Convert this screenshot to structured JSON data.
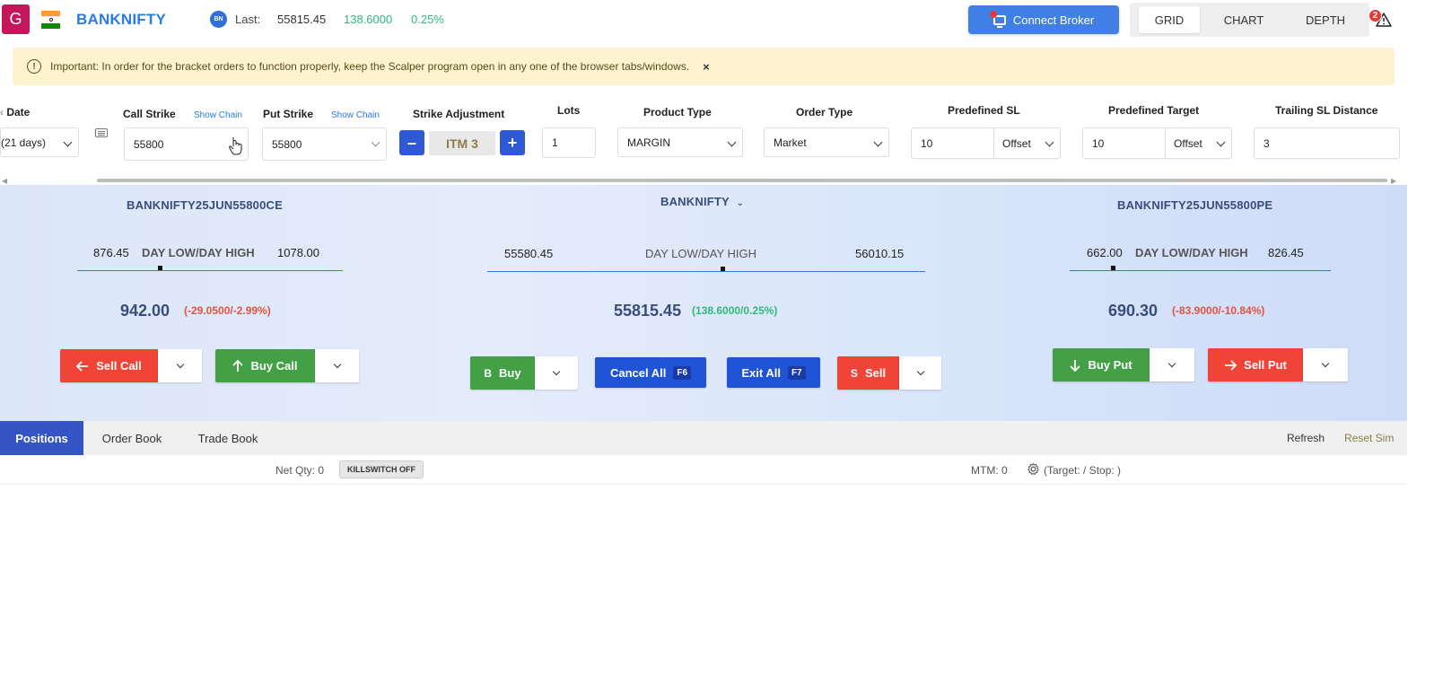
{
  "header": {
    "avatar_letter": "G",
    "symbol": "BANKNIFTY",
    "bn_icon": "BN",
    "last_label": "Last:",
    "last_price": "55815.45",
    "last_change": "138.6000",
    "last_pct": "0.25%",
    "connect_label": "Connect Broker",
    "views": [
      "GRID",
      "CHART",
      "DEPTH"
    ],
    "active_view": "GRID",
    "notif_count": "2"
  },
  "alert": {
    "icon": "!",
    "text": "Important: In order for the bracket orders to function properly, keep the Scalper program open in any one of the browser tabs/windows.",
    "close": "×"
  },
  "form": {
    "date_label": "Date",
    "date_value": "(21 days)",
    "call_strike_label": "Call Strike",
    "call_chain_link": "Show Chain",
    "call_strike_value": "55800",
    "put_strike_label": "Put Strike",
    "put_chain_link": "Show Chain",
    "put_strike_value": "55800",
    "strike_adj_label": "Strike Adjustment",
    "adj_minus": "–",
    "adj_value": "ITM 3",
    "adj_plus": "+",
    "lots_label": "Lots",
    "lots_value": "1",
    "product_label": "Product Type",
    "product_value": "MARGIN",
    "order_type_label": "Order Type",
    "order_type_value": "Market",
    "sl_label": "Predefined SL",
    "sl_value": "10",
    "sl_mode": "Offset",
    "target_label": "Predefined Target",
    "target_value": "10",
    "target_mode": "Offset",
    "trail_label": "Trailing SL Distance",
    "trail_value": "3"
  },
  "panel": {
    "call": {
      "contract": "BANKNIFTY25JUN55800CE",
      "day_low": "876.45",
      "range_label": "DAY LOW/DAY HIGH",
      "day_high": "1078.00",
      "ltp": "942.00",
      "change": "(-29.0500/-2.99%)",
      "sell_label": "Sell Call",
      "buy_label": "Buy Call"
    },
    "index": {
      "name": "BANKNIFTY",
      "day_low": "55580.45",
      "range_label": "DAY LOW/DAY HIGH",
      "day_high": "56010.15",
      "ltp": "55815.45",
      "change": "(138.6000/0.25%)",
      "buy_letter": "B",
      "buy_label": "Buy",
      "cancel_label": "Cancel All",
      "cancel_key": "F6",
      "exit_label": "Exit All",
      "exit_key": "F7",
      "sell_letter": "S",
      "sell_label": "Sell"
    },
    "put": {
      "contract": "BANKNIFTY25JUN55800PE",
      "day_low": "662.00",
      "range_label": "DAY LOW/DAY HIGH",
      "day_high": "826.45",
      "ltp": "690.30",
      "change": "(-83.9000/-10.84%)",
      "buy_label": "Buy Put",
      "sell_label": "Sell Put"
    }
  },
  "tabs": {
    "items": [
      "Positions",
      "Order Book",
      "Trade Book"
    ],
    "active": "Positions",
    "refresh": "Refresh",
    "reset": "Reset Sim"
  },
  "status": {
    "net_qty": "Net Qty: 0",
    "killswitch": "KILLSWITCH OFF",
    "mtm": "MTM: 0",
    "target_stop": "(Target: / Stop: )"
  },
  "colors": {
    "accent": "#2a7be4",
    "sell": "#f04438",
    "buy": "#43a047",
    "action_blue": "#1f54d6",
    "tab_active": "#3554c6",
    "positive": "#2fb87a",
    "negative": "#e5533d"
  }
}
